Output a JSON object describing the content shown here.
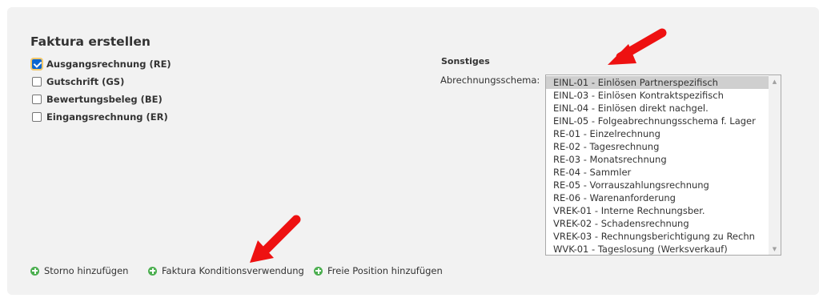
{
  "panel": {
    "title": "Faktura erstellen"
  },
  "checkboxes": [
    {
      "label": "Ausgangsrechnung (RE)",
      "checked": true
    },
    {
      "label": "Gutschrift (GS)",
      "checked": false
    },
    {
      "label": "Bewertungsbeleg (BE)",
      "checked": false
    },
    {
      "label": "Eingangsrechnung (ER)",
      "checked": false
    }
  ],
  "sonstiges": {
    "heading": "Sonstiges",
    "schema_label": "Abrechnungsschema:",
    "options": [
      "EINL-01 - Einlösen Partnerspezifisch",
      "EINL-03 - Einlösen Kontraktspezifisch",
      "EINL-04 - Einlösen direkt nachgel.",
      "EINL-05 - Folgeabrechnungsschema f. Lager",
      "RE-01 - Einzelrechnung",
      "RE-02 - Tagesrechnung",
      "RE-03 - Monatsrechnung",
      "RE-04 - Sammler",
      "RE-05 - Vorrauszahlungsrechnung",
      "RE-06 - Warenanforderung",
      "VREK-01 - Interne Rechnungsber.",
      "VREK-02 - Schadensrechnung",
      "VREK-03 - Rechnungsberichtigung zu Rechn",
      "WVK-01 - Tageslosung (Werksverkauf)"
    ],
    "selected_option": "EINL-01 - Einlösen Partnerspezifisch"
  },
  "actions": [
    {
      "label": "Storno hinzufügen",
      "icon": "plus-circle-icon"
    },
    {
      "label": "Faktura Konditionsverwendung",
      "icon": "plus-circle-icon"
    },
    {
      "label": "Freie Position hinzufügen",
      "icon": "plus-circle-icon"
    }
  ],
  "colors": {
    "panel_bg": "#f2f2f2",
    "checkbox_checked": "#0b66d0",
    "checkbox_focus": "#f3c86a",
    "action_icon": "#4caf50",
    "annotation_arrow": "#ee1111",
    "selected_option_bg": "#cfcfcf"
  }
}
